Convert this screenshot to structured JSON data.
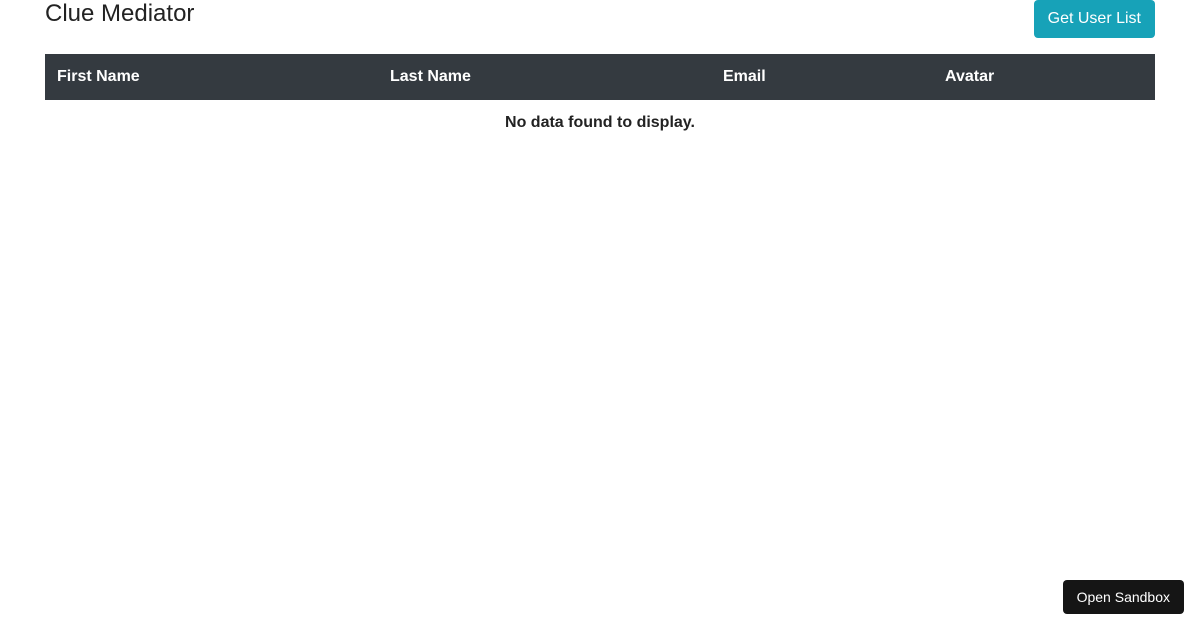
{
  "header": {
    "title": "Clue Mediator",
    "get_user_button": "Get User List"
  },
  "table": {
    "columns": [
      "First Name",
      "Last Name",
      "Email",
      "Avatar"
    ],
    "empty_message": "No data found to display."
  },
  "footer": {
    "open_sandbox": "Open Sandbox"
  }
}
